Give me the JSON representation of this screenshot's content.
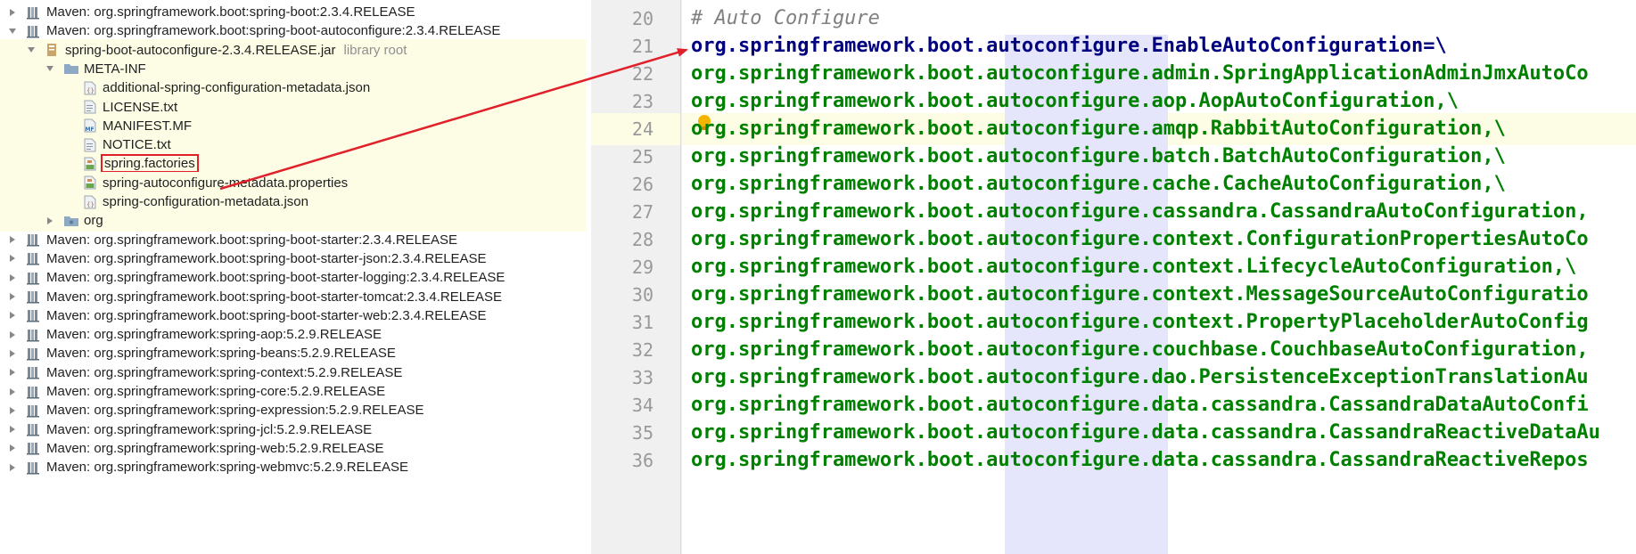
{
  "project_tree": {
    "rows": [
      {
        "indent": 0,
        "twisty": "closed",
        "icon": "library-icon",
        "label": "Maven: org.springframework.boot:spring-boot:2.3.4.RELEASE"
      },
      {
        "indent": 0,
        "twisty": "open",
        "icon": "library-icon",
        "label": "Maven: org.springframework.boot:spring-boot-autoconfigure:2.3.4.RELEASE"
      },
      {
        "indent": 1,
        "twisty": "open",
        "icon": "jar-icon",
        "label": "spring-boot-autoconfigure-2.3.4.RELEASE.jar",
        "sub": "library root",
        "highlight": true
      },
      {
        "indent": 2,
        "twisty": "open",
        "icon": "folder-icon",
        "label": "META-INF",
        "highlight": true
      },
      {
        "indent": 3,
        "twisty": "none",
        "icon": "json-file-icon",
        "label": "additional-spring-configuration-metadata.json",
        "highlight": true
      },
      {
        "indent": 3,
        "twisty": "none",
        "icon": "text-file-icon",
        "label": "LICENSE.txt",
        "highlight": true
      },
      {
        "indent": 3,
        "twisty": "none",
        "icon": "manifest-file-icon",
        "label": "MANIFEST.MF",
        "highlight": true
      },
      {
        "indent": 3,
        "twisty": "none",
        "icon": "text-file-icon",
        "label": "NOTICE.txt",
        "highlight": true
      },
      {
        "indent": 3,
        "twisty": "none",
        "icon": "properties-file-icon",
        "label": "spring.factories",
        "highlight": true,
        "boxed": true
      },
      {
        "indent": 3,
        "twisty": "none",
        "icon": "properties-file-icon",
        "label": "spring-autoconfigure-metadata.properties",
        "highlight": true
      },
      {
        "indent": 3,
        "twisty": "none",
        "icon": "json-file-icon",
        "label": "spring-configuration-metadata.json",
        "highlight": true
      },
      {
        "indent": 2,
        "twisty": "closed",
        "icon": "package-folder-icon",
        "label": "org",
        "highlight": true
      },
      {
        "indent": 0,
        "twisty": "closed",
        "icon": "library-icon",
        "label": "Maven: org.springframework.boot:spring-boot-starter:2.3.4.RELEASE"
      },
      {
        "indent": 0,
        "twisty": "closed",
        "icon": "library-icon",
        "label": "Maven: org.springframework.boot:spring-boot-starter-json:2.3.4.RELEASE"
      },
      {
        "indent": 0,
        "twisty": "closed",
        "icon": "library-icon",
        "label": "Maven: org.springframework.boot:spring-boot-starter-logging:2.3.4.RELEASE"
      },
      {
        "indent": 0,
        "twisty": "closed",
        "icon": "library-icon",
        "label": "Maven: org.springframework.boot:spring-boot-starter-tomcat:2.3.4.RELEASE"
      },
      {
        "indent": 0,
        "twisty": "closed",
        "icon": "library-icon",
        "label": "Maven: org.springframework.boot:spring-boot-starter-web:2.3.4.RELEASE"
      },
      {
        "indent": 0,
        "twisty": "closed",
        "icon": "library-icon",
        "label": "Maven: org.springframework:spring-aop:5.2.9.RELEASE"
      },
      {
        "indent": 0,
        "twisty": "closed",
        "icon": "library-icon",
        "label": "Maven: org.springframework:spring-beans:5.2.9.RELEASE"
      },
      {
        "indent": 0,
        "twisty": "closed",
        "icon": "library-icon",
        "label": "Maven: org.springframework:spring-context:5.2.9.RELEASE"
      },
      {
        "indent": 0,
        "twisty": "closed",
        "icon": "library-icon",
        "label": "Maven: org.springframework:spring-core:5.2.9.RELEASE"
      },
      {
        "indent": 0,
        "twisty": "closed",
        "icon": "library-icon",
        "label": "Maven: org.springframework:spring-expression:5.2.9.RELEASE"
      },
      {
        "indent": 0,
        "twisty": "closed",
        "icon": "library-icon",
        "label": "Maven: org.springframework:spring-jcl:5.2.9.RELEASE"
      },
      {
        "indent": 0,
        "twisty": "closed",
        "icon": "library-icon",
        "label": "Maven: org.springframework:spring-web:5.2.9.RELEASE"
      },
      {
        "indent": 0,
        "twisty": "closed",
        "icon": "library-icon",
        "label": "Maven: org.springframework:spring-webmvc:5.2.9.RELEASE"
      }
    ]
  },
  "editor": {
    "current_line": 24,
    "lines": [
      {
        "num": "20",
        "segments": [
          {
            "t": "# Auto Configure",
            "c": "comment"
          }
        ]
      },
      {
        "num": "21",
        "segments": [
          {
            "t": "org.springframework.boot.autoconfigure.EnableAutoConfiguration",
            "c": "key"
          },
          {
            "t": "=\\",
            "c": "op"
          }
        ]
      },
      {
        "num": "22",
        "segments": [
          {
            "t": "org.springframework.boot.autoconfigure.admin.SpringApplicationAdminJmxAutoCo",
            "c": "val"
          }
        ]
      },
      {
        "num": "23",
        "segments": [
          {
            "t": "org.springframework.boot.autoconfigure.aop.AopAutoConfiguration,\\",
            "c": "val"
          }
        ]
      },
      {
        "num": "24",
        "segments": [
          {
            "t": "org.springframework.boot.autoconfigure.amqp.RabbitAutoConfiguration,\\",
            "c": "val"
          }
        ]
      },
      {
        "num": "25",
        "segments": [
          {
            "t": "org.springframework.boot.autoconfigure.batch.BatchAutoConfiguration,\\",
            "c": "val"
          }
        ]
      },
      {
        "num": "26",
        "segments": [
          {
            "t": "org.springframework.boot.autoconfigure.cache.CacheAutoConfiguration,\\",
            "c": "val"
          }
        ]
      },
      {
        "num": "27",
        "segments": [
          {
            "t": "org.springframework.boot.autoconfigure.cassandra.CassandraAutoConfiguration,",
            "c": "val"
          }
        ]
      },
      {
        "num": "28",
        "segments": [
          {
            "t": "org.springframework.boot.autoconfigure.context.ConfigurationPropertiesAutoCo",
            "c": "val"
          }
        ]
      },
      {
        "num": "29",
        "segments": [
          {
            "t": "org.springframework.boot.autoconfigure.context.LifecycleAutoConfiguration,\\",
            "c": "val"
          }
        ]
      },
      {
        "num": "30",
        "segments": [
          {
            "t": "org.springframework.boot.autoconfigure.context.MessageSourceAutoConfiguratio",
            "c": "val"
          }
        ]
      },
      {
        "num": "31",
        "segments": [
          {
            "t": "org.springframework.boot.autoconfigure.context.PropertyPlaceholderAutoConfig",
            "c": "val"
          }
        ]
      },
      {
        "num": "32",
        "segments": [
          {
            "t": "org.springframework.boot.autoconfigure.couchbase.CouchbaseAutoConfiguration,",
            "c": "val"
          }
        ]
      },
      {
        "num": "33",
        "segments": [
          {
            "t": "org.springframework.boot.autoconfigure.dao.PersistenceExceptionTranslationAu",
            "c": "val"
          }
        ]
      },
      {
        "num": "34",
        "segments": [
          {
            "t": "org.springframework.boot.autoconfigure.data.cassandra.CassandraDataAutoConfi",
            "c": "val"
          }
        ]
      },
      {
        "num": "35",
        "segments": [
          {
            "t": "org.springframework.boot.autoconfigure.data.cassandra.CassandraReactiveDataAu",
            "c": "val"
          }
        ]
      },
      {
        "num": "36",
        "segments": [
          {
            "t": "org.springframework.boot.autoconfigure.data.cassandra.CassandraReactiveRepos",
            "c": "val"
          }
        ]
      }
    ]
  },
  "colors": {
    "comment": "#808080",
    "key": "#000080",
    "value": "#008000",
    "annotation": "#e0202a",
    "highlight_bg": "#fdfde6",
    "column_highlight": "#e5e5fb"
  }
}
